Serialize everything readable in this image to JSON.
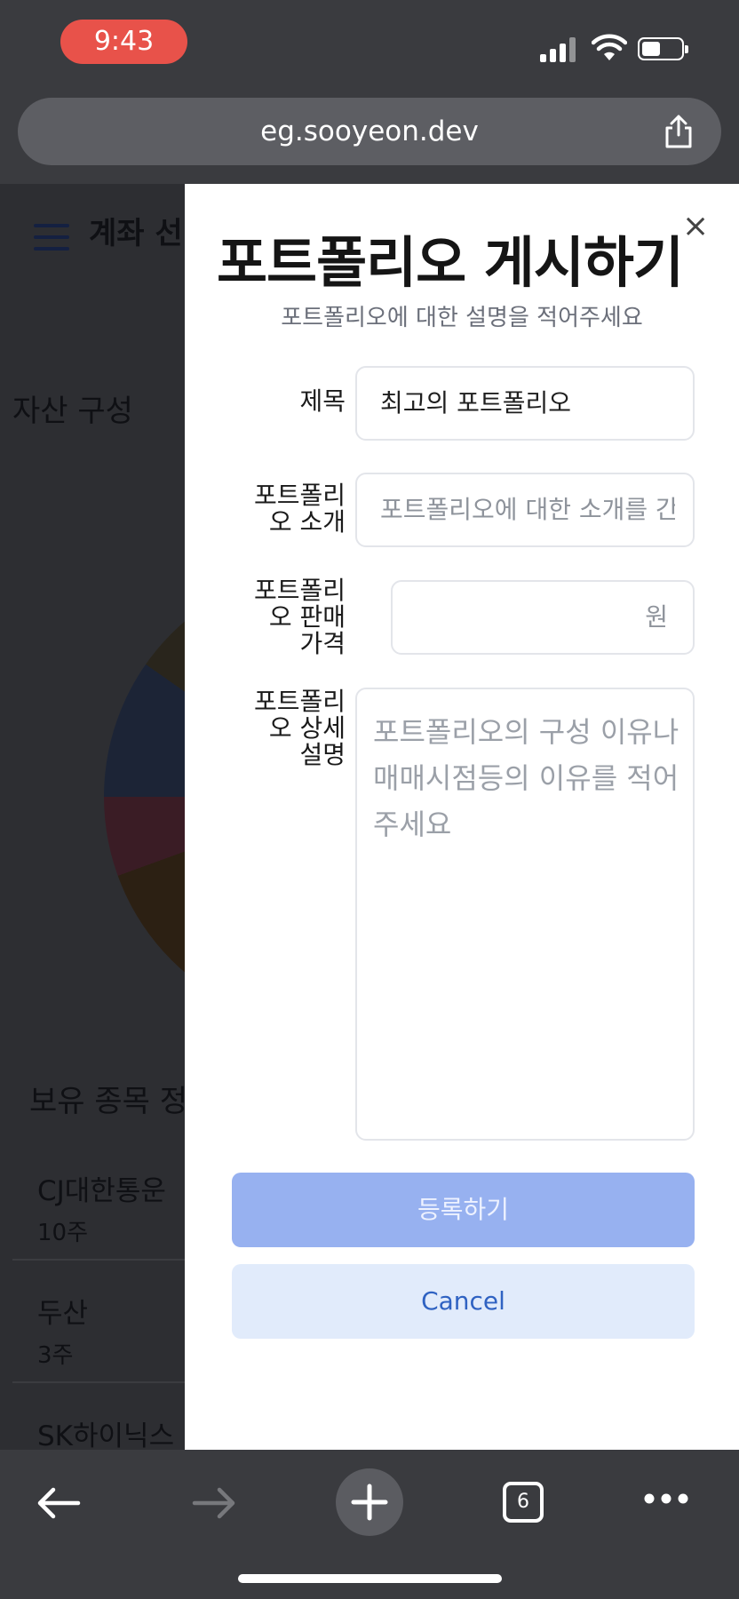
{
  "status_bar": {
    "time": "9:43"
  },
  "browser": {
    "url": "eg.sooyeon.dev",
    "tab_count": "6"
  },
  "background_page": {
    "header_title": "계좌 선",
    "section_asset": "자산 구성",
    "section_holdings": "보유 종목 정",
    "holdings": [
      {
        "name": "CJ대한통운",
        "qty": "10주"
      },
      {
        "name": "두산",
        "qty": "3주"
      },
      {
        "name": "SK하이닉스",
        "qty": ""
      }
    ]
  },
  "modal": {
    "title": "포트폴리오 게시하기",
    "subtitle": "포트폴리오에 대한 설명을 적어주세요",
    "close_label": "×",
    "fields": {
      "title": {
        "label": "제목",
        "value": "최고의 포트폴리오"
      },
      "intro": {
        "label_line1": "포트폴리",
        "label_line2": "오 소개",
        "placeholder": "포트폴리오에 대한 소개를 간"
      },
      "price": {
        "label_line1": "포트폴리",
        "label_line2": "오 판매",
        "label_line3": "가격",
        "suffix": "원"
      },
      "detail": {
        "label_line1": "포트폴리",
        "label_line2": "오 상세",
        "label_line3": "설명",
        "placeholder": "포트폴리오의 구성 이유나 매매시점등의 이유를 적어주세요"
      }
    },
    "submit_label": "등록하기",
    "cancel_label": "Cancel"
  },
  "colors": {
    "accent": "#97b1f0",
    "cancel_bg": "#e1ebfb",
    "time_pill": "#e8524a"
  }
}
